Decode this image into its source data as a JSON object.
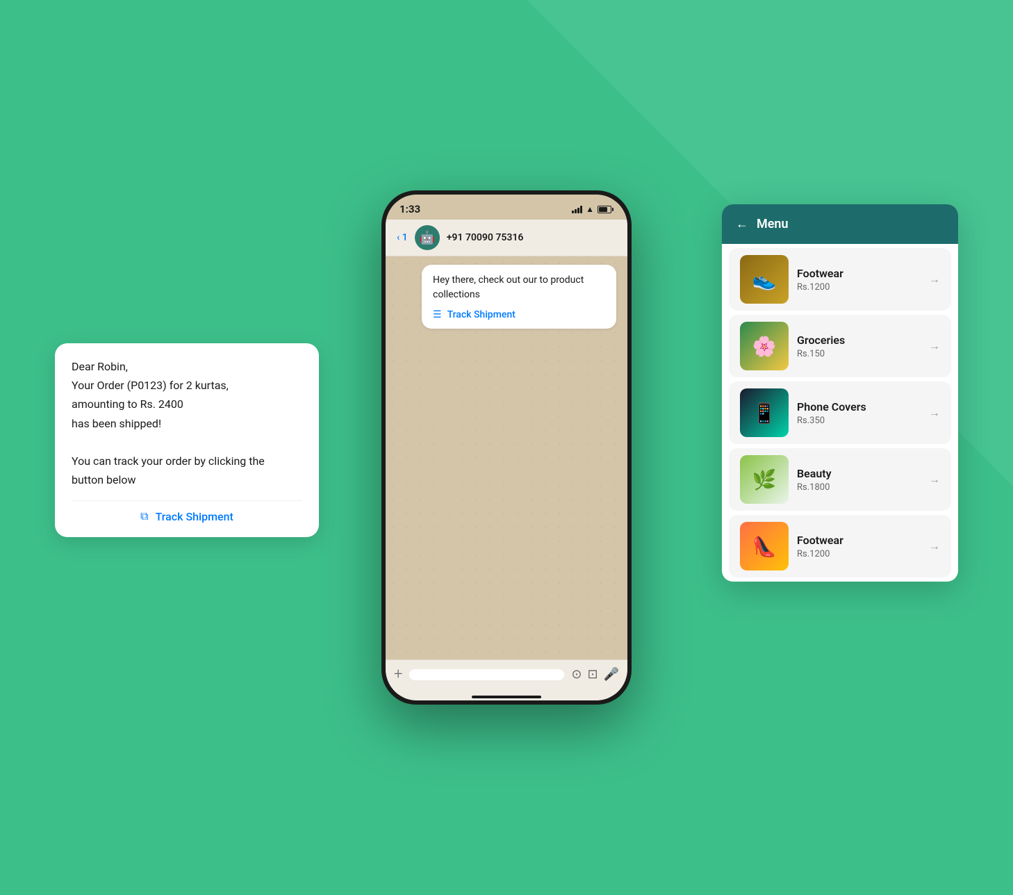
{
  "background": {
    "color": "#3dbf8a"
  },
  "status_bar": {
    "time": "1:33",
    "phone_number": "+91 70090 75316"
  },
  "bubble_1": {
    "text": "Hey there, check out our to product collections",
    "link": "Track Shipment"
  },
  "order_bubble": {
    "greeting": "Dear Robin,",
    "line1": "Your Order (P0123) for 2 kurtas,",
    "line2": "amounting to Rs. 2400",
    "line3": "has been shipped!",
    "line4": "",
    "line5": "You can track your order by clicking the",
    "line6": "button below",
    "link": "Track Shipment"
  },
  "menu": {
    "title": "Menu",
    "back_label": "←",
    "items": [
      {
        "name": "Footwear",
        "price": "Rs.1200",
        "emoji": "👟"
      },
      {
        "name": "Groceries",
        "price": "Rs.150",
        "emoji": "🌸"
      },
      {
        "name": "Phone Covers",
        "price": "Rs.350",
        "emoji": "📱"
      },
      {
        "name": "Beauty",
        "price": "Rs.1800",
        "emoji": "🌿"
      },
      {
        "name": "Footwear",
        "price": "Rs.1200",
        "emoji": "👠"
      }
    ]
  },
  "input_bar": {
    "plus": "+",
    "icons": [
      "⟳",
      "📷",
      "🎤"
    ]
  }
}
